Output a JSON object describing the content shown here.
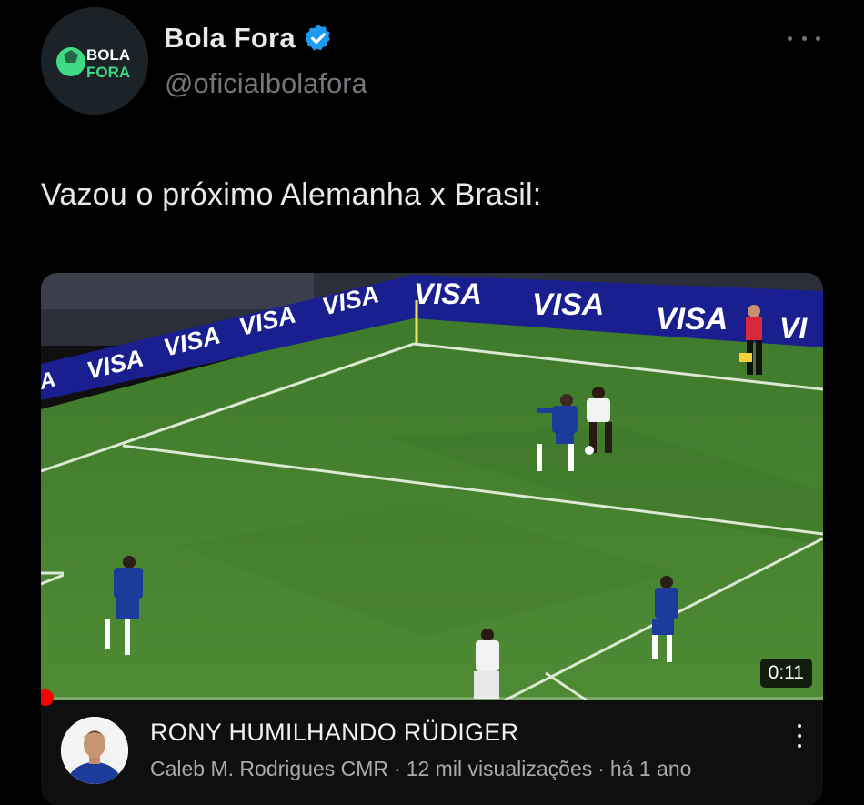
{
  "tweet": {
    "author": {
      "display_name": "Bola Fora",
      "handle": "@oficialbolafora",
      "verified": true,
      "avatar_logo_text": [
        "BOLA",
        "FORA"
      ],
      "avatar_logo_colors": [
        "#ffffff",
        "#3ddc84"
      ]
    },
    "text": "Vazou o próximo Alemanha x Brasil:",
    "more_icon": "more-horizontal-icon"
  },
  "video": {
    "duration": "0:11",
    "progress": 0.01,
    "board_text": [
      "VISA",
      "VISA",
      "VISA",
      "VISA",
      "VISA",
      "VISA",
      "VISA",
      "VI",
      "A"
    ],
    "title": "RONY HUMILHANDO RÜDIGER",
    "channel": "Caleb M. Rodrigues CMR",
    "views": "12 mil visualizações",
    "age": "há 1 ano",
    "separator": "·",
    "more_icon": "more-vertical-icon"
  },
  "colors": {
    "background": "#000000",
    "text_primary": "#e7e9ea",
    "text_secondary": "#71767b",
    "verified_blue": "#1d9bf0",
    "progress_red": "#ff0000",
    "pitch_green": "#4f8a34",
    "board_blue": "#1a1f8f"
  }
}
